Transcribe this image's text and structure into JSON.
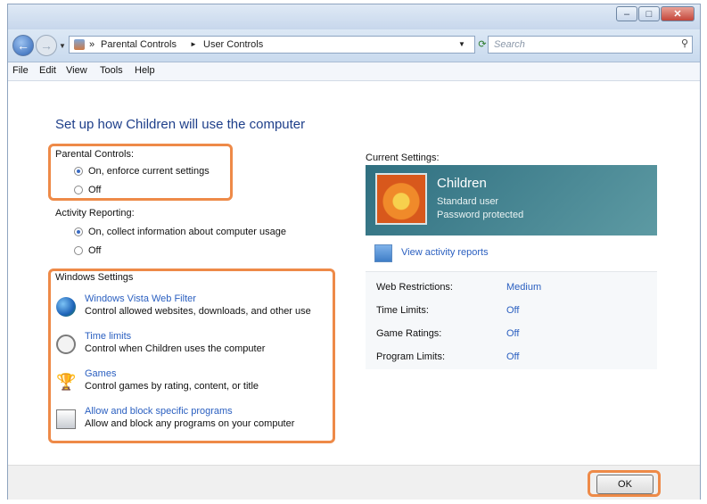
{
  "address": {
    "crumbs": [
      "Parental Controls",
      "User Controls"
    ],
    "separator": "»",
    "arrow": "►",
    "search_placeholder": "Search"
  },
  "menu": [
    "File",
    "Edit",
    "View",
    "Tools",
    "Help"
  ],
  "heading": "Set up how Children will use the computer",
  "parental_controls": {
    "label": "Parental Controls:",
    "options": [
      {
        "label": "On, enforce current settings",
        "selected": true
      },
      {
        "label": "Off",
        "selected": false
      }
    ]
  },
  "activity_reporting": {
    "label": "Activity Reporting:",
    "options": [
      {
        "label": "On, collect information about computer usage",
        "selected": true
      },
      {
        "label": "Off",
        "selected": false
      }
    ]
  },
  "windows_settings": {
    "label": "Windows Settings",
    "items": [
      {
        "icon": "globe-icon",
        "link": "Windows Vista Web Filter",
        "desc": "Control allowed websites, downloads, and other use"
      },
      {
        "icon": "clock-icon",
        "link": "Time limits",
        "desc": "Control when Children uses the computer"
      },
      {
        "icon": "trophy-icon",
        "link": "Games",
        "desc": "Control games by rating, content, or title"
      },
      {
        "icon": "program-icon",
        "link": "Allow and block specific programs",
        "desc": "Allow and block any programs on your computer"
      }
    ]
  },
  "current_settings": {
    "label": "Current Settings:",
    "user_name": "Children",
    "user_type": "Standard user",
    "password_status": "Password protected",
    "activity_link": "View activity reports",
    "rows": [
      {
        "key": "Web Restrictions:",
        "value": "Medium"
      },
      {
        "key": "Time Limits:",
        "value": "Off"
      },
      {
        "key": "Game Ratings:",
        "value": "Off"
      },
      {
        "key": "Program Limits:",
        "value": "Off"
      }
    ]
  },
  "ok_label": "OK",
  "colors": {
    "highlight": "#ee8a48",
    "link": "#2a5fc0",
    "banner": "#2f6f80"
  }
}
